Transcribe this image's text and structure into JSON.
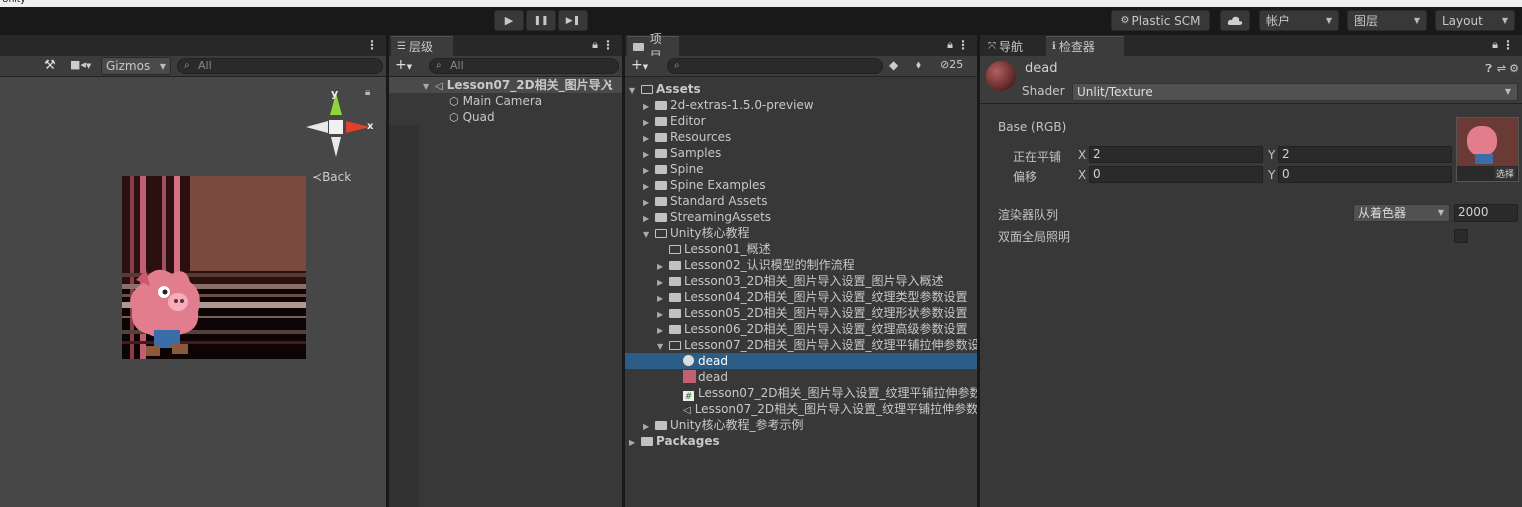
{
  "toolbar": {
    "play_label": "▶",
    "pause_label": "❚❚",
    "step_label": "▶❚",
    "plastic_label": "Plastic SCM",
    "account_label": "帐户",
    "layers_label": "图层",
    "layout_label": "Layout"
  },
  "scene": {
    "gizmos_label": "Gizmos",
    "search_placeholder": "All",
    "axis_y": "y",
    "axis_x": "x",
    "back_label": "Back"
  },
  "hierarchy": {
    "tab_label": "层级",
    "search_placeholder": "All",
    "scene_name": "Lesson07_2D相关_图片导入",
    "items": [
      "Main Camera",
      "Quad"
    ]
  },
  "project": {
    "tab_label": "项目",
    "hidden_count": "25",
    "assets_label": "Assets",
    "folders": [
      "2d-extras-1.5.0-preview",
      "Editor",
      "Resources",
      "Samples",
      "Spine",
      "Spine Examples",
      "Standard Assets",
      "StreamingAssets"
    ],
    "unity_course": "Unity核心教程",
    "lessons": [
      "Lesson01_概述",
      "Lesson02_认识模型的制作流程",
      "Lesson03_2D相关_图片导入设置_图片导入概述",
      "Lesson04_2D相关_图片导入设置_纹理类型参数设置",
      "Lesson05_2D相关_图片导入设置_纹理形状参数设置",
      "Lesson06_2D相关_图片导入设置_纹理高级参数设置",
      "Lesson07_2D相关_图片导入设置_纹理平铺拉伸参数设"
    ],
    "lesson07_items": [
      "dead",
      "dead",
      "Lesson07_2D相关_图片导入设置_纹理平铺拉伸参数",
      "Lesson07_2D相关_图片导入设置_纹理平铺拉伸参数"
    ],
    "unity_example": "Unity核心教程_参考示例",
    "packages_label": "Packages"
  },
  "inspector": {
    "tab_nav": "导航",
    "tab_inspector": "检查器",
    "material_name": "dead",
    "shader_label": "Shader",
    "shader_value": "Unlit/Texture",
    "base_label": "Base (RGB)",
    "tiling_label": "正在平铺",
    "offset_label": "偏移",
    "x_label": "X",
    "y_label": "Y",
    "tiling_x": "2",
    "tiling_y": "2",
    "offset_x": "0",
    "offset_y": "0",
    "select_label": "选择",
    "render_queue_label": "渲染器队列",
    "render_queue_mode": "从着色器",
    "render_queue_value": "2000",
    "double_gi_label": "双面全局照明"
  },
  "colors": {
    "selection": "#2c5d87",
    "panel": "#383838",
    "axis_y": "#8ed53b",
    "axis_x": "#e0402c"
  }
}
